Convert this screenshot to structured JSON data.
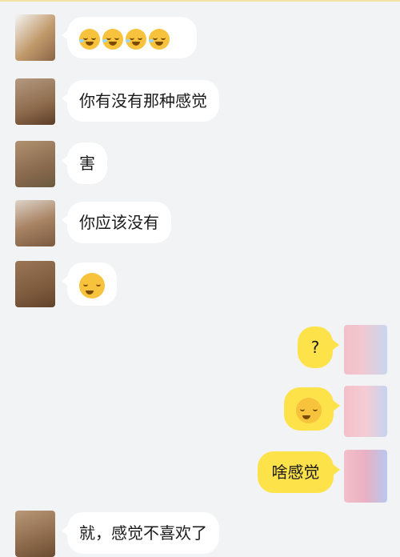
{
  "messages": [
    {
      "side": "left",
      "text": ""
    },
    {
      "side": "left",
      "text": "你有没有那种感觉"
    },
    {
      "side": "left",
      "text": "害"
    },
    {
      "side": "left",
      "text": "你应该没有"
    },
    {
      "side": "left",
      "text": ""
    },
    {
      "side": "right",
      "text": "?"
    },
    {
      "side": "right",
      "text": ""
    },
    {
      "side": "right",
      "text": "啥感觉"
    },
    {
      "side": "left",
      "text": "就，感觉不喜欢了"
    }
  ],
  "emoji_names": {
    "m0": "crying-laughing-emoji",
    "m4": "side-eye-emoji",
    "m6": "pondering-emoji"
  },
  "colors": {
    "background": "#f2f3f5",
    "incoming_bubble": "#ffffff",
    "outgoing_bubble": "#fde24a",
    "emoji": "#f7c23c"
  }
}
